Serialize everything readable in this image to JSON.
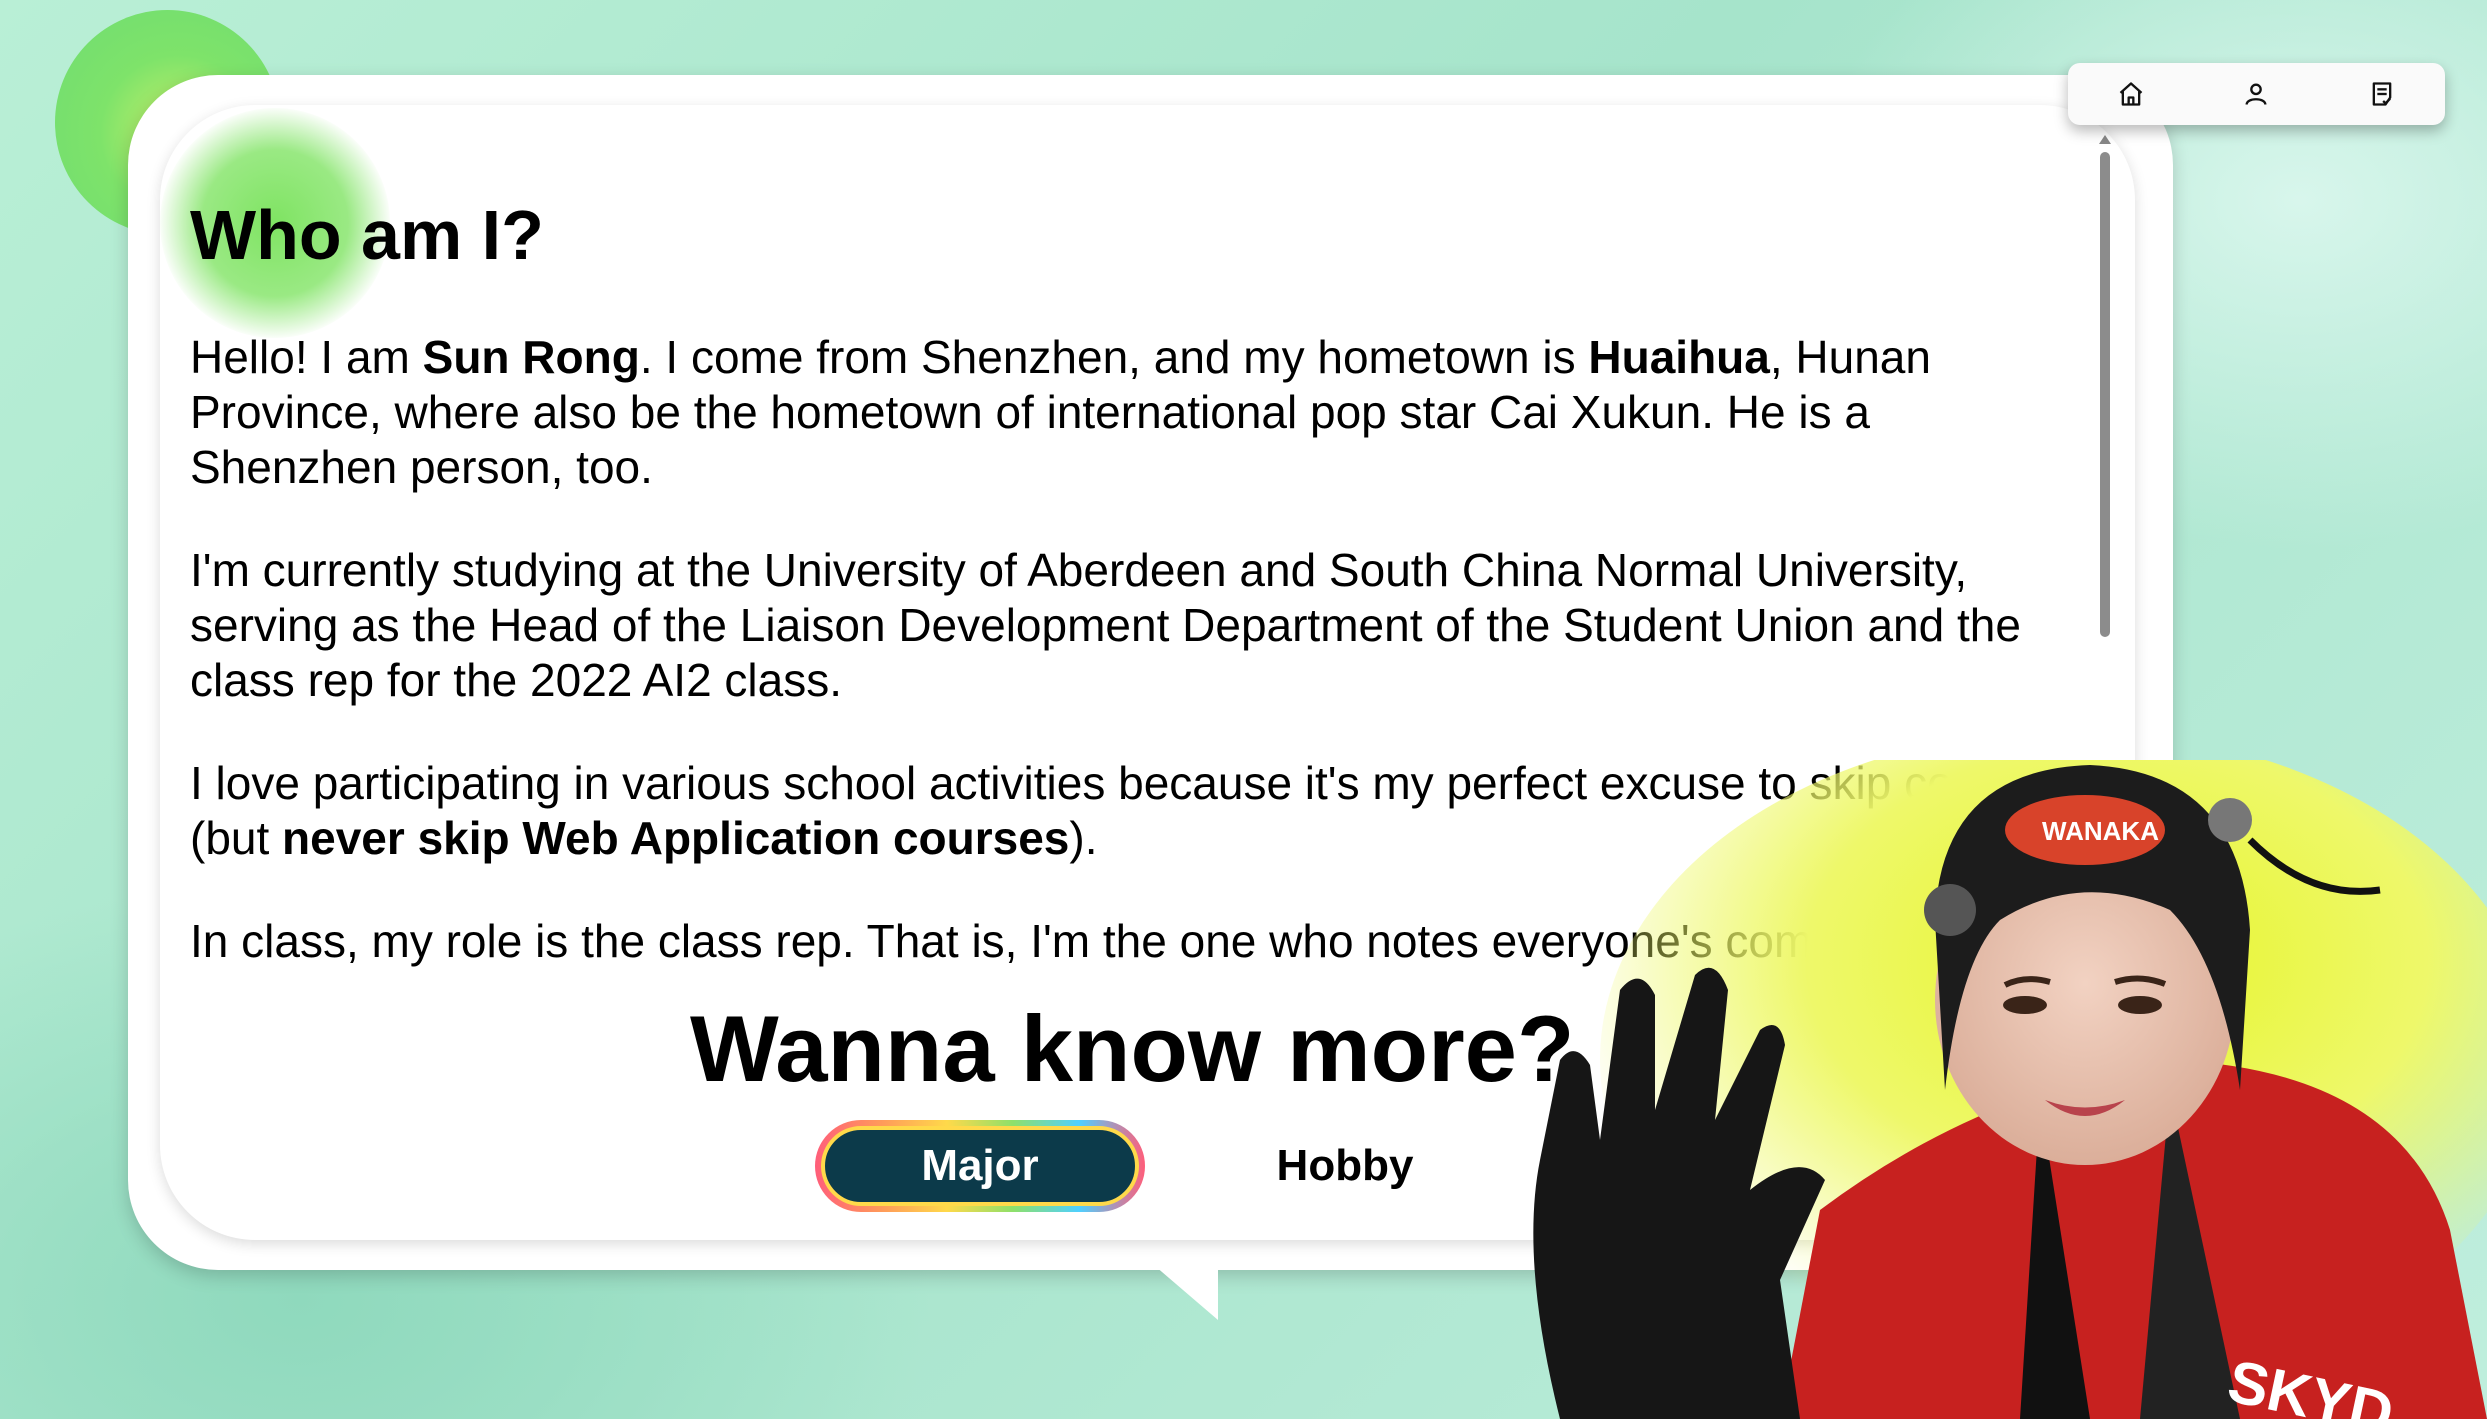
{
  "about": {
    "heading": "Who am I?",
    "p1": {
      "a": "Hello! I am ",
      "b_name": "Sun Rong",
      "c": ". I come from Shenzhen, and my hometown is ",
      "d_hometown": "Huaihua",
      "e": ", Hunan Province, where also be the hometown of international pop star Cai Xukun. He is a Shenzhen person, too."
    },
    "p2": "I'm currently studying at the University of Aberdeen and South China Normal University, serving as the Head of the Liaison Development Department of the Student Union and the class rep for the 2022 AI2 class.",
    "p3": {
      "a": "I love participating in various school activities because it's my perfect excuse to skip courses (but ",
      "b_bold": "never skip Web Application courses",
      "c": ")."
    },
    "p4": "In class, my role is the class rep. That is, I'm the one who notes everyone's compla"
  },
  "more": {
    "title": "Wanna know more?",
    "major_label": "Major",
    "hobby_label": "Hobby"
  },
  "nav": {
    "icons": [
      "home-icon",
      "user-icon",
      "notes-icon"
    ]
  },
  "photo": {
    "helmet_text": "WANAKA",
    "jacket_text": "SKYD"
  },
  "colors": {
    "background": "#b9efd6",
    "accent_green": "#7ee36a",
    "major_button_bg": "#0c3a4a"
  }
}
